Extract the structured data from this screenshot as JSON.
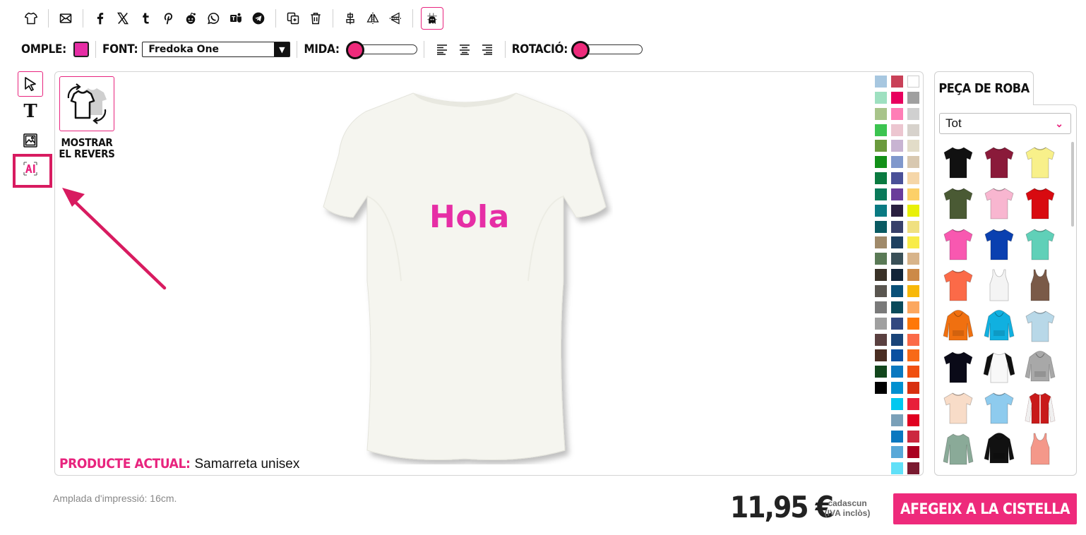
{
  "toolbar": {
    "icons": [
      "tshirt-icon",
      "mail-icon",
      "facebook-icon",
      "x-icon",
      "tumblr-icon",
      "pinterest-icon",
      "reddit-icon",
      "whatsapp-icon",
      "teams-icon",
      "telegram-icon",
      "duplicate-icon",
      "trash-icon",
      "align-center-icon",
      "flip-horizontal-icon",
      "flip-vertical-icon",
      "grid-guide-icon"
    ]
  },
  "format": {
    "fill_label": "OMPLE:",
    "fill_color": "#e62ea5",
    "font_label": "FONT:",
    "font_value": "Fredoka One",
    "size_label": "MIDA:",
    "size_level": 0,
    "rotation_label": "ROTACIÓ:",
    "rotation_level": 0
  },
  "tools": [
    "select-icon",
    "text-icon",
    "image-icon",
    "ai-icon"
  ],
  "canvas": {
    "revers_label": "MOSTRAR EL REVERS",
    "design_text": "Hola",
    "product_key": "PRODUCTE ACTUAL:",
    "product_value": "Samarreta unisex",
    "palette": [
      "#a7c7e0",
      "#c94158",
      "#ffffff",
      "#9ee0c0",
      "#e8005e",
      "#a0a0a0",
      "#a8c48a",
      "#ff7eb6",
      "#d0d0d0",
      "#3cc450",
      "#ecc6d0",
      "#d7d2cc",
      "#6a9a3c",
      "#c8b4d2",
      "#e2dcc8",
      "#129018",
      "#8098cc",
      "#d8c8b0",
      "#0a7a40",
      "#4a5098",
      "#f5d6a8",
      "#0a7a5a",
      "#6a3c9a",
      "#fcd068",
      "#0a7a82",
      "#2a2040",
      "#e8f008",
      "#0a5a62",
      "#38406a",
      "#f0e080",
      "#a08a6a",
      "#1e4060",
      "#f8ec48",
      "#5a7a56",
      "#3a5058",
      "#d8b48a",
      "#3a3228",
      "#122438",
      "#cc8a48",
      "#5a5650",
      "#0a5078",
      "#f8b808",
      "#7a7a7a",
      "#0a4a5a",
      "#fca860",
      "#a0a0a0",
      "#324880",
      "#ff7808",
      "#5a4040",
      "#1a4478",
      "#fb6a48",
      "#4a2e22",
      "#0a50a0",
      "#f86a18",
      "#12461c",
      "#0a78c0",
      "#f05010",
      "#000000",
      "#0090d0",
      "#d83010",
      "",
      "#00c8f0",
      "#e8203a",
      "",
      "#7aa0b8",
      "#e00020",
      "",
      "#0a78c0",
      "#cc2840",
      "",
      "#58a8d8",
      "#aa0020",
      "",
      "#60e0f8",
      "#7a1a30"
    ]
  },
  "panel": {
    "tab_label": "PEÇA DE ROBA",
    "filter_value": "Tot",
    "items": [
      {
        "name": "black-tshirt",
        "color": "#111111",
        "kind": "tee"
      },
      {
        "name": "burgundy-tshirt",
        "color": "#8a1a3a",
        "kind": "tee"
      },
      {
        "name": "yellow-tshirt",
        "color": "#f8f08a",
        "kind": "tee"
      },
      {
        "name": "olive-tshirt",
        "color": "#4a5a34",
        "kind": "tee"
      },
      {
        "name": "pink-women-tshirt",
        "color": "#f8b6d0",
        "kind": "tee"
      },
      {
        "name": "red-tshirt",
        "color": "#d80a10",
        "kind": "tee"
      },
      {
        "name": "fuchsia-women-tshirt",
        "color": "#f858b0",
        "kind": "tee"
      },
      {
        "name": "royal-blue-tshirt",
        "color": "#0a40b0",
        "kind": "tee"
      },
      {
        "name": "mint-tshirt",
        "color": "#60d0b8",
        "kind": "tee"
      },
      {
        "name": "coral-tshirt",
        "color": "#fb6a48",
        "kind": "tee"
      },
      {
        "name": "white-tank-top",
        "color": "#f4f4f4",
        "kind": "tank"
      },
      {
        "name": "brown-tank-top",
        "color": "#7a5a48",
        "kind": "tank"
      },
      {
        "name": "orange-hoodie",
        "color": "#f07010",
        "kind": "hoodie"
      },
      {
        "name": "cyan-hoodie",
        "color": "#10b0e0",
        "kind": "hoodie"
      },
      {
        "name": "tiedye-tshirt",
        "color": "#b8d8e8",
        "kind": "tee"
      },
      {
        "name": "black-tshirt-2",
        "color": "#0a0a18",
        "kind": "tee"
      },
      {
        "name": "raglan-tshirt",
        "color": "#f8f8f8",
        "kind": "raglan"
      },
      {
        "name": "grey-hoodie",
        "color": "#a8a8a8",
        "kind": "hoodie"
      },
      {
        "name": "peach-tshirt",
        "color": "#f8dcc8",
        "kind": "tee"
      },
      {
        "name": "sky-gradient-tshirt",
        "color": "#8ecbee",
        "kind": "tee"
      },
      {
        "name": "varsity-jacket",
        "color": "#c81a1a",
        "kind": "jacket"
      },
      {
        "name": "sage-longsleeve",
        "color": "#8aaa98",
        "kind": "longsleeve"
      },
      {
        "name": "black-orange-hoodie",
        "color": "#111111",
        "kind": "hoodie"
      },
      {
        "name": "salmon-tank-top",
        "color": "#f4988a",
        "kind": "tank"
      }
    ]
  },
  "footer": {
    "print_width": "Amplada d'impressió: 16cm.",
    "price": "11,95 €",
    "price_note_1": "cadascun",
    "price_note_2": "(IVA inclòs)",
    "cart_label": "AFEGEIX A LA CISTELLA"
  },
  "colors": {
    "accent": "#ee2a7b",
    "highlight_box": "#d81b60"
  }
}
